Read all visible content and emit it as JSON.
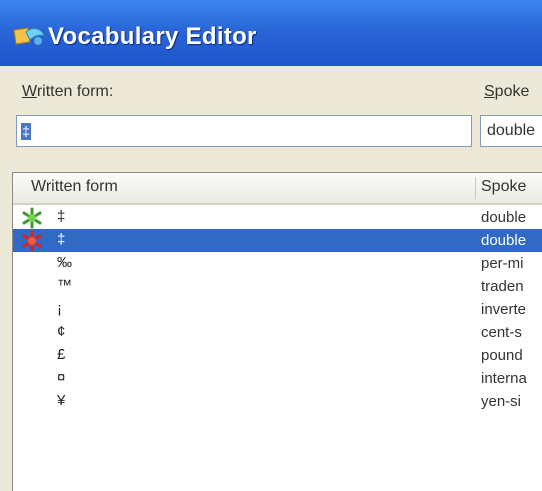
{
  "window": {
    "title": "Vocabulary Editor",
    "app_icon": "vocabulary-editor-icon"
  },
  "form": {
    "written_label_pre": "",
    "written_label_accel": "W",
    "written_label_post": "ritten form:",
    "spoken_label_pre": "",
    "spoken_label_accel": "S",
    "spoken_label_post": "poke",
    "written_value": "‡",
    "spoken_value": "double"
  },
  "list": {
    "columns": [
      "Written form",
      "Spoke"
    ],
    "rows": [
      {
        "icon": "green-asterisk-icon",
        "written": "‡",
        "spoken": "double",
        "selected": false
      },
      {
        "icon": "red-asterisk-icon",
        "written": "‡",
        "spoken": "double",
        "selected": true
      },
      {
        "icon": "",
        "written": "‰",
        "spoken": "per-mi",
        "selected": false
      },
      {
        "icon": "",
        "written": "™",
        "spoken": "traden",
        "selected": false
      },
      {
        "icon": "",
        "written": "¡",
        "spoken": "inverte",
        "selected": false
      },
      {
        "icon": "",
        "written": "¢",
        "spoken": "cent-s",
        "selected": false
      },
      {
        "icon": "",
        "written": "£",
        "spoken": "pound",
        "selected": false
      },
      {
        "icon": "",
        "written": "¤",
        "spoken": "interna",
        "selected": false
      },
      {
        "icon": "",
        "written": "¥",
        "spoken": "yen-si",
        "selected": false
      }
    ]
  },
  "colors": {
    "titlebar": "#2a66d8",
    "selection": "#316ac5",
    "dialog_bg": "#ece9d8"
  }
}
